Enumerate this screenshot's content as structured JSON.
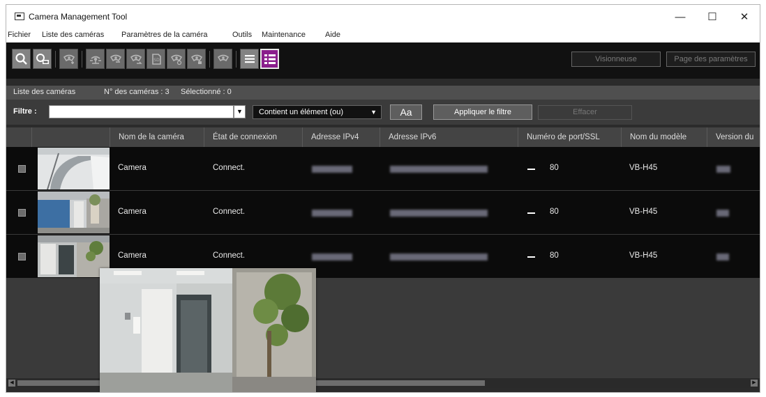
{
  "window": {
    "title": "Camera Management Tool",
    "minimize": "—",
    "maximize": "☐",
    "close": "✕"
  },
  "menu": [
    "Fichier",
    "Liste des caméras",
    "Paramètres de la caméra",
    "Outils",
    "Maintenance",
    "Aide"
  ],
  "toolbar": {
    "icons": [
      "search-icon",
      "search-new-icon",
      "camera-add-icon",
      "network-icon",
      "camera-settings-icon",
      "camera-sync-icon",
      "sd-card-icon",
      "camera-refresh-icon",
      "camera-tools-icon",
      "camera-restart-icon",
      "list-view-icon",
      "detail-list-view-icon"
    ],
    "sd_label": "SD",
    "viewer_label": "Visionneuse",
    "settings_page_label": "Page des paramètres"
  },
  "info": {
    "list_label": "Liste des caméras",
    "count_label": "N° des caméras : 3",
    "selected_label": "Sélectionné : 0"
  },
  "filter": {
    "label": "Filtre :",
    "value": "",
    "mode": "Contient un élément (ou)",
    "case_label": "Aa",
    "apply_label": "Appliquer le filtre",
    "clear_label": "Effacer"
  },
  "table": {
    "columns": [
      "",
      "",
      "Nom de la caméra",
      "État de connexion",
      "Adresse IPv4",
      "Adresse IPv6",
      "Numéro de port/SSL",
      "Nom du modèle",
      "Version du"
    ],
    "rows": [
      {
        "name": "Camera",
        "status": "Connect.",
        "port": "80",
        "model": "VB-H45"
      },
      {
        "name": "Camera",
        "status": "Connect.",
        "port": "80",
        "model": "VB-H45"
      },
      {
        "name": "Camera",
        "status": "Connect.",
        "port": "80",
        "model": "VB-H45"
      }
    ]
  },
  "colors": {
    "accent": "#8a1e8c",
    "background": "#2b2b2b",
    "row": "#0b0b0b",
    "header": "#444444"
  }
}
